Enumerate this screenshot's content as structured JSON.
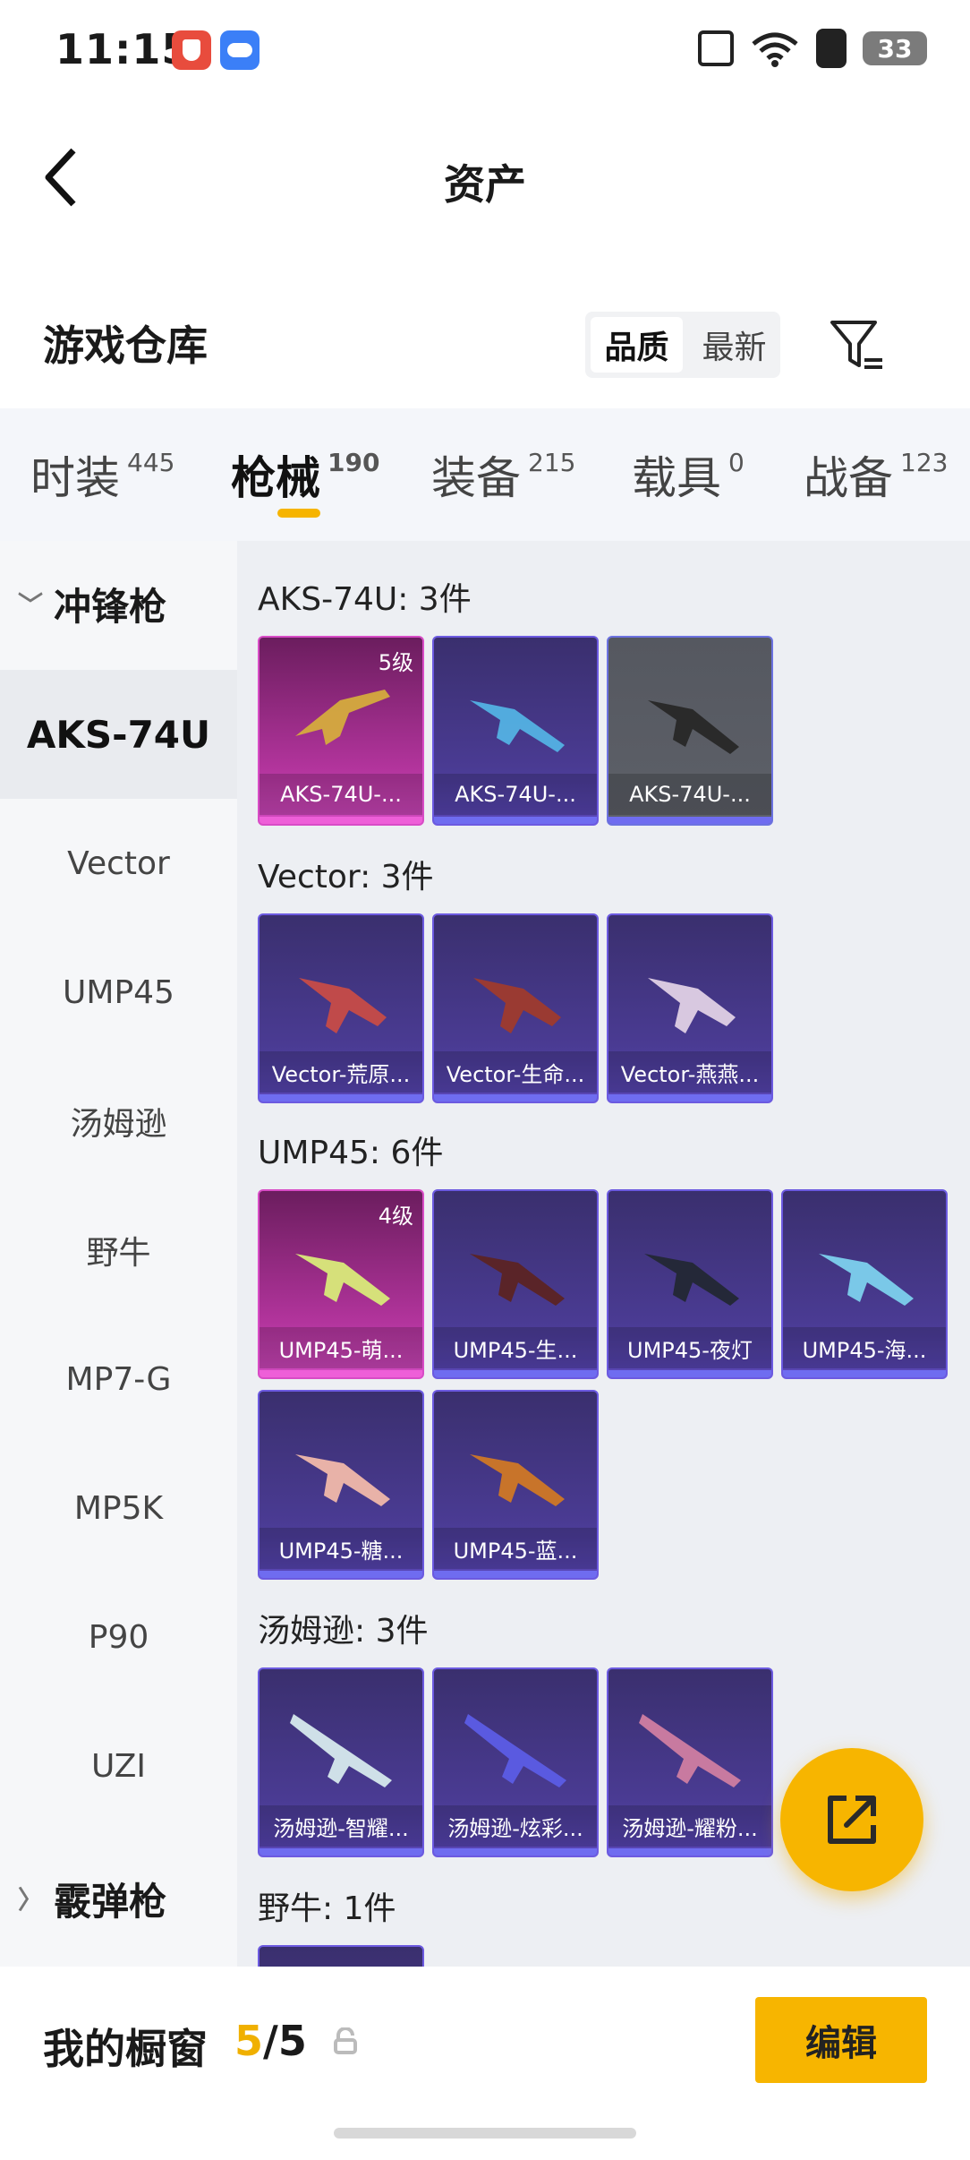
{
  "status_bar": {
    "time": "11:15",
    "battery": "33"
  },
  "header": {
    "title": "资产"
  },
  "warehouse": {
    "title": "游戏仓库",
    "sort_options": [
      "品质",
      "最新"
    ],
    "active_sort": "品质"
  },
  "tabs": [
    {
      "label": "时装",
      "count": "445"
    },
    {
      "label": "枪械",
      "count": "190"
    },
    {
      "label": "装备",
      "count": "215"
    },
    {
      "label": "载具",
      "count": "0"
    },
    {
      "label": "战备",
      "count": "123"
    }
  ],
  "sidebar": {
    "section_open": "冲锋枪",
    "items": [
      "AKS-74U",
      "Vector",
      "UMP45",
      "汤姆逊",
      "野牛",
      "MP7-G",
      "MP5K",
      "P90",
      "UZI"
    ],
    "section_closed": "霰弹枪"
  },
  "groups": [
    {
      "title": "AKS-74U: 3件",
      "items": [
        {
          "label": "AKS-74U-...",
          "quality": "pink",
          "level": "5级"
        },
        {
          "label": "AKS-74U-...",
          "quality": "purple",
          "level": ""
        },
        {
          "label": "AKS-74U-...",
          "quality": "gray",
          "level": ""
        }
      ]
    },
    {
      "title": "Vector: 3件",
      "items": [
        {
          "label": "Vector-荒原...",
          "quality": "purple",
          "level": ""
        },
        {
          "label": "Vector-生命...",
          "quality": "purple",
          "level": ""
        },
        {
          "label": "Vector-燕燕...",
          "quality": "purple",
          "level": ""
        }
      ]
    },
    {
      "title": "UMP45: 6件",
      "items": [
        {
          "label": "UMP45-萌...",
          "quality": "pink",
          "level": "4级"
        },
        {
          "label": "UMP45-生...",
          "quality": "purple",
          "level": ""
        },
        {
          "label": "UMP45-夜灯",
          "quality": "purple",
          "level": ""
        },
        {
          "label": "UMP45-海...",
          "quality": "purple",
          "level": ""
        },
        {
          "label": "UMP45-糖...",
          "quality": "purple",
          "level": ""
        },
        {
          "label": "UMP45-蓝...",
          "quality": "purple",
          "level": ""
        }
      ]
    },
    {
      "title": "汤姆逊: 3件",
      "items": [
        {
          "label": "汤姆逊-智耀...",
          "quality": "purple",
          "level": ""
        },
        {
          "label": "汤姆逊-炫彩...",
          "quality": "purple",
          "level": ""
        },
        {
          "label": "汤姆逊-耀粉...",
          "quality": "purple",
          "level": ""
        }
      ]
    },
    {
      "title": "野牛: 1件",
      "items": []
    }
  ],
  "bottom": {
    "label": "我的橱窗",
    "count_current": "5",
    "count_sep": "/5",
    "edit_label": "编辑"
  },
  "colors": {
    "accent": "#f7b500",
    "purple_quality": "#4a3b93",
    "pink_quality": "#b2349c"
  }
}
